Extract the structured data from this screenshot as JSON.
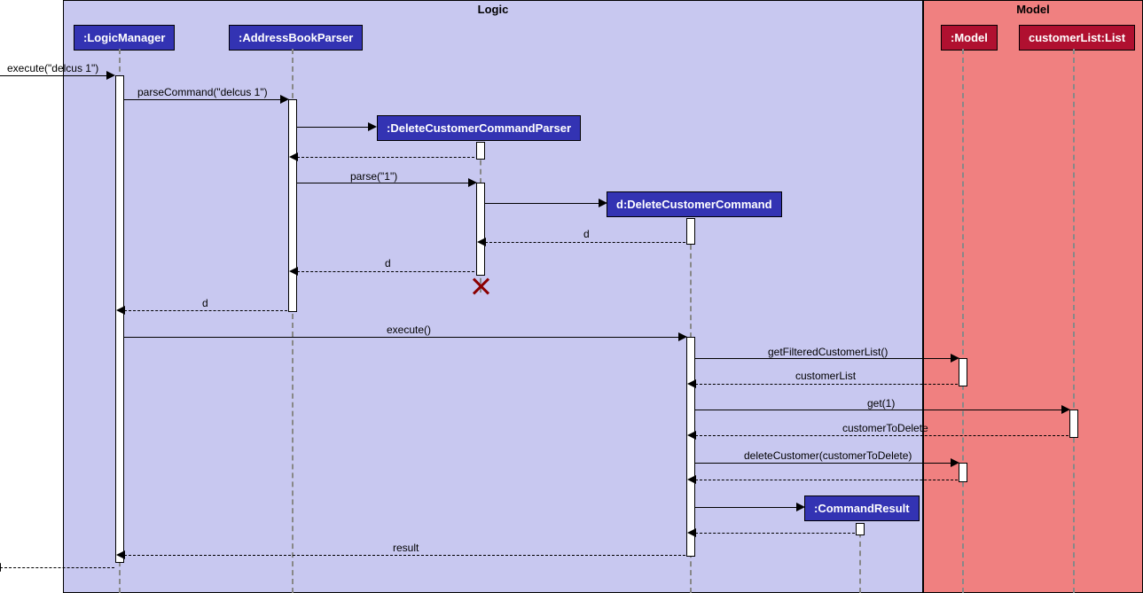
{
  "frames": {
    "logic": "Logic",
    "model": "Model"
  },
  "participants": {
    "logicManager": ":LogicManager",
    "addressBookParser": ":AddressBookParser",
    "deleteCustomerCommandParser": ":DeleteCustomerCommandParser",
    "deleteCustomerCommand": "d:DeleteCustomerCommand",
    "commandResult": ":CommandResult",
    "model": ":Model",
    "customerList": "customerList:List"
  },
  "messages": {
    "execute1": "execute(\"delcus 1\")",
    "parseCommand": "parseCommand(\"delcus 1\")",
    "parse": "parse(\"1\")",
    "d1": "d",
    "d2": "d",
    "d3": "d",
    "execute2": "execute()",
    "getFilteredCustomerList": "getFilteredCustomerList()",
    "customerListReturn": "customerList",
    "get1": "get(1)",
    "customerToDelete": "customerToDelete",
    "deleteCustomer": "deleteCustomer(customerToDelete)",
    "result": "result"
  }
}
